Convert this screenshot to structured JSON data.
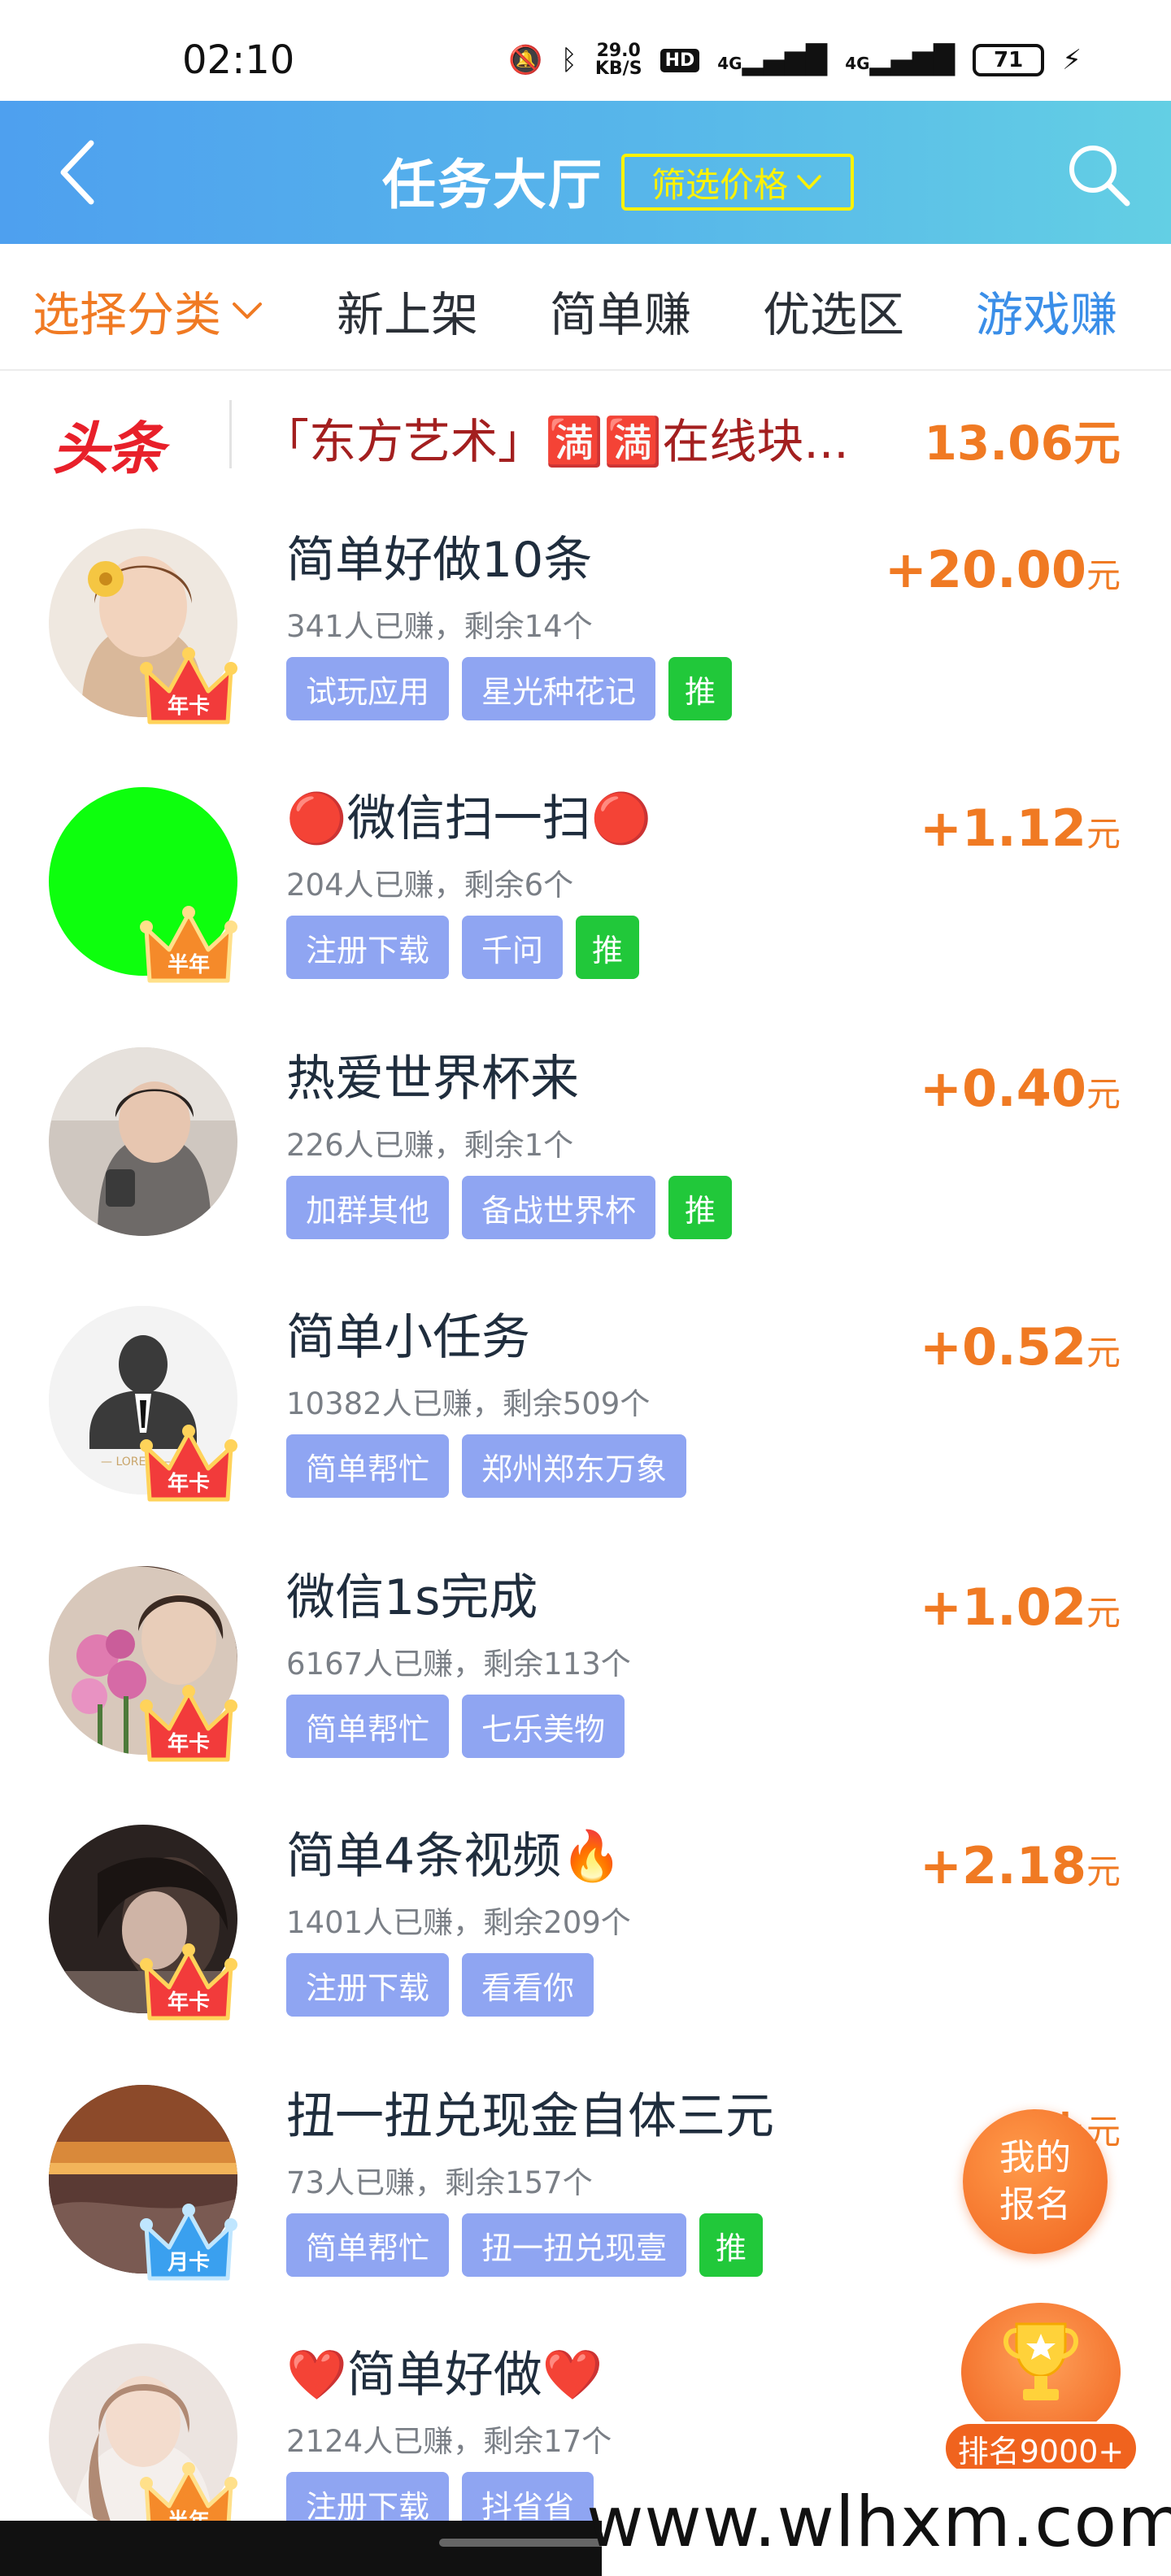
{
  "status_bar": {
    "time": "02:10",
    "speed_value": "29.0",
    "speed_unit": "KB/S",
    "hd_label": "HD",
    "net_1": "4G",
    "net_2": "4G",
    "battery": "71"
  },
  "header": {
    "title": "任务大厅",
    "filter_label": "筛选价格"
  },
  "tabs": {
    "category_label": "选择分类",
    "items": [
      "新上架",
      "简单赚",
      "优选区",
      "游戏赚"
    ]
  },
  "headline": {
    "tag": "头条",
    "text": "「东方艺术」🈵🈵在线块...",
    "amount": "13.06元"
  },
  "tasks": [
    {
      "title": "简单好做10条",
      "meta": "341人已赚，剩余14个",
      "tags": [
        "试玩应用",
        "星光种花记"
      ],
      "push": "推",
      "reward_prefix": "+",
      "reward": "20.00",
      "unit": "元",
      "badge": "年卡",
      "badge_color": "#f23b3b"
    },
    {
      "title": "🔴微信扫一扫🔴",
      "meta": "204人已赚，剩余6个",
      "tags": [
        "注册下载",
        "千问"
      ],
      "push": "推",
      "reward_prefix": "+",
      "reward": "1.12",
      "unit": "元",
      "badge": "半年",
      "badge_color": "#f58a2a"
    },
    {
      "title": "热爱世界杯来",
      "meta": "226人已赚，剩余1个",
      "tags": [
        "加群其他",
        "备战世界杯"
      ],
      "push": "推",
      "reward_prefix": "+",
      "reward": "0.40",
      "unit": "元",
      "badge": "",
      "badge_color": ""
    },
    {
      "title": "简单小任务",
      "meta": "10382人已赚，剩余509个",
      "tags": [
        "简单帮忙",
        "郑州郑东万象"
      ],
      "push": "",
      "reward_prefix": "+",
      "reward": "0.52",
      "unit": "元",
      "badge": "年卡",
      "badge_color": "#f23b3b"
    },
    {
      "title": "微信1s完成",
      "meta": "6167人已赚，剩余113个",
      "tags": [
        "简单帮忙",
        "七乐美物"
      ],
      "push": "",
      "reward_prefix": "+",
      "reward": "1.02",
      "unit": "元",
      "badge": "年卡",
      "badge_color": "#f23b3b"
    },
    {
      "title": "简单4条视频🔥",
      "meta": "1401人已赚，剩余209个",
      "tags": [
        "注册下载",
        "看看你"
      ],
      "push": "",
      "reward_prefix": "+",
      "reward": "2.18",
      "unit": "元",
      "badge": "年卡",
      "badge_color": "#f23b3b"
    },
    {
      "title": "扭一扭兑现金自体三元",
      "meta": "73人已赚，剩余157个",
      "tags": [
        "简单帮忙",
        "扭一扭兑现壹"
      ],
      "push": "推",
      "reward_prefix": "+",
      "reward": "",
      "unit": "元",
      "badge": "月卡",
      "badge_color": "#3aa0ef"
    },
    {
      "title": "❤️简单好做❤️",
      "meta": "2124人已赚，剩余17个",
      "tags": [
        "注册下载",
        "抖省省"
      ],
      "push": "",
      "reward_prefix": "",
      "reward": "",
      "unit": "",
      "badge": "半年",
      "badge_color": "#f58a2a"
    }
  ],
  "float": {
    "signup_line1": "我的",
    "signup_line2": "报名",
    "rank_label": "排名9000+"
  },
  "watermark": "www.wlhxm.com",
  "colors": {
    "accent_orange": "#f07a23",
    "tag_blue": "#8fa5f2",
    "push_green": "#21c83a",
    "header_gradient_start": "#4ea0ef",
    "header_gradient_end": "#63cfe4",
    "headline_red": "#e8202a"
  },
  "icons": {
    "back": "chevron-left-icon",
    "filter_arrow": "chevron-down-icon",
    "search": "search-icon",
    "category_arrow": "chevron-down-icon",
    "crown": "crown-icon",
    "trophy": "trophy-icon"
  }
}
